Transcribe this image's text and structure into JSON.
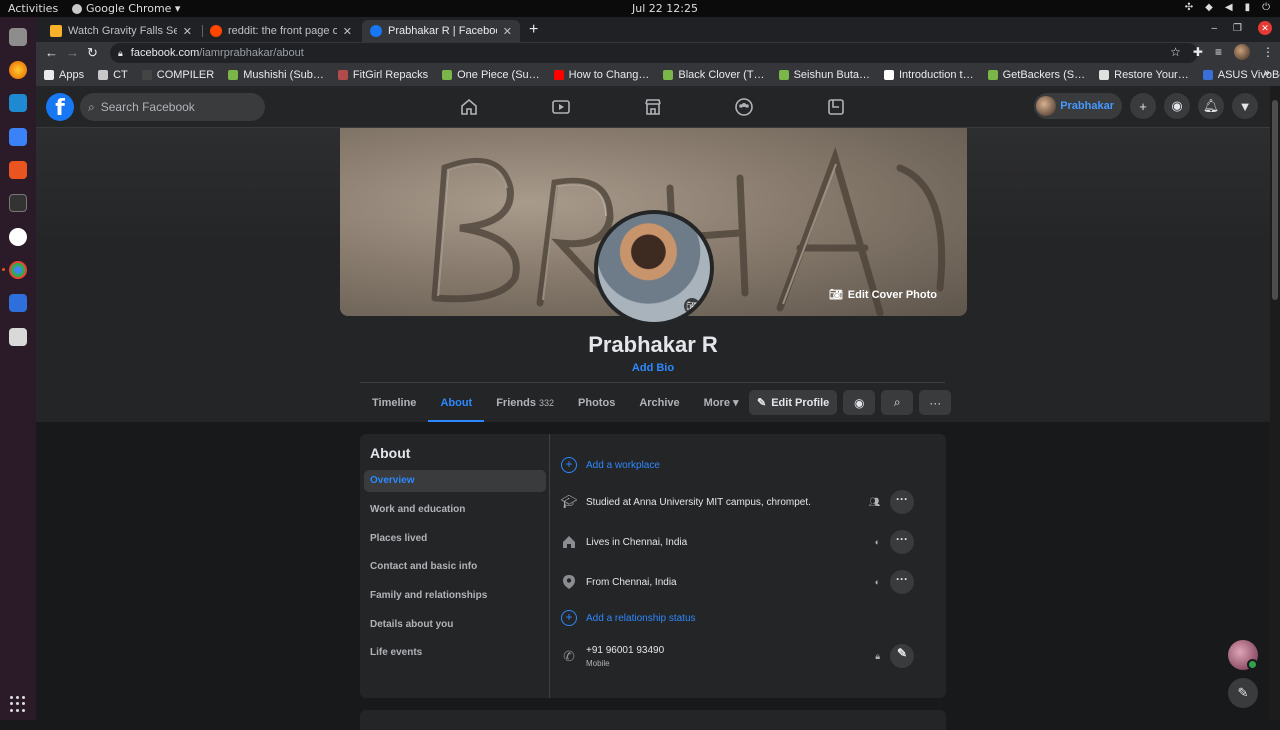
{
  "system": {
    "activities": "Activities",
    "app_name": "Google Chrome ▾",
    "clock": "Jul 22  12:25"
  },
  "browser": {
    "tabs": [
      {
        "title": "Watch Gravity Falls Seaso",
        "color": "#f7b22a"
      },
      {
        "title": "reddit: the front page of t",
        "color": "#ff4500"
      },
      {
        "title": "Prabhakar R | Facebook",
        "color": "#1877f2"
      }
    ],
    "url_domain": "facebook.com",
    "url_path": "/iamrprabhakar/about",
    "bookmarks": [
      {
        "label": "Apps",
        "color": "#e8eaed"
      },
      {
        "label": "CT",
        "color": "#c8c8c8"
      },
      {
        "label": "COMPILER",
        "color": "#444"
      },
      {
        "label": "Mushishi (Sub…",
        "color": "#7ab648"
      },
      {
        "label": "FitGirl Repacks",
        "color": "#b24b4b"
      },
      {
        "label": "One Piece (Su…",
        "color": "#7ab648"
      },
      {
        "label": "How to Chang…",
        "color": "#ff0000"
      },
      {
        "label": "Black Clover (T…",
        "color": "#7ab648"
      },
      {
        "label": "Seishun Buta…",
        "color": "#7ab648"
      },
      {
        "label": "Introduction t…",
        "color": "#ffffff"
      },
      {
        "label": "GetBackers (S…",
        "color": "#7ab648"
      },
      {
        "label": "Restore Your…",
        "color": "#e0e0e0"
      },
      {
        "label": "ASUS VivoBoo…",
        "color": "#3a6fd8"
      }
    ]
  },
  "facebook": {
    "search_placeholder": "Search Facebook",
    "user_short": "Prabhakar",
    "profile_name": "Prabhakar R",
    "add_bio": "Add Bio",
    "edit_cover": "Edit Cover Photo",
    "tabs": [
      {
        "label": "Timeline"
      },
      {
        "label": "About"
      },
      {
        "label": "Friends",
        "count": "332"
      },
      {
        "label": "Photos"
      },
      {
        "label": "Archive"
      },
      {
        "label": "More ▾"
      }
    ],
    "edit_profile": "Edit Profile",
    "about": {
      "title": "About",
      "side": [
        "Overview",
        "Work and education",
        "Places lived",
        "Contact and basic info",
        "Family and relationships",
        "Details about you",
        "Life events"
      ],
      "rows": {
        "workplace": "Add a workplace",
        "studied": "Studied at Anna University MIT campus, chrompet.",
        "lives": "Lives in Chennai, India",
        "from": "From Chennai, India",
        "relationship": "Add a relationship status",
        "phone": "+91 96001 93490",
        "phone_sub": "Mobile"
      }
    }
  }
}
